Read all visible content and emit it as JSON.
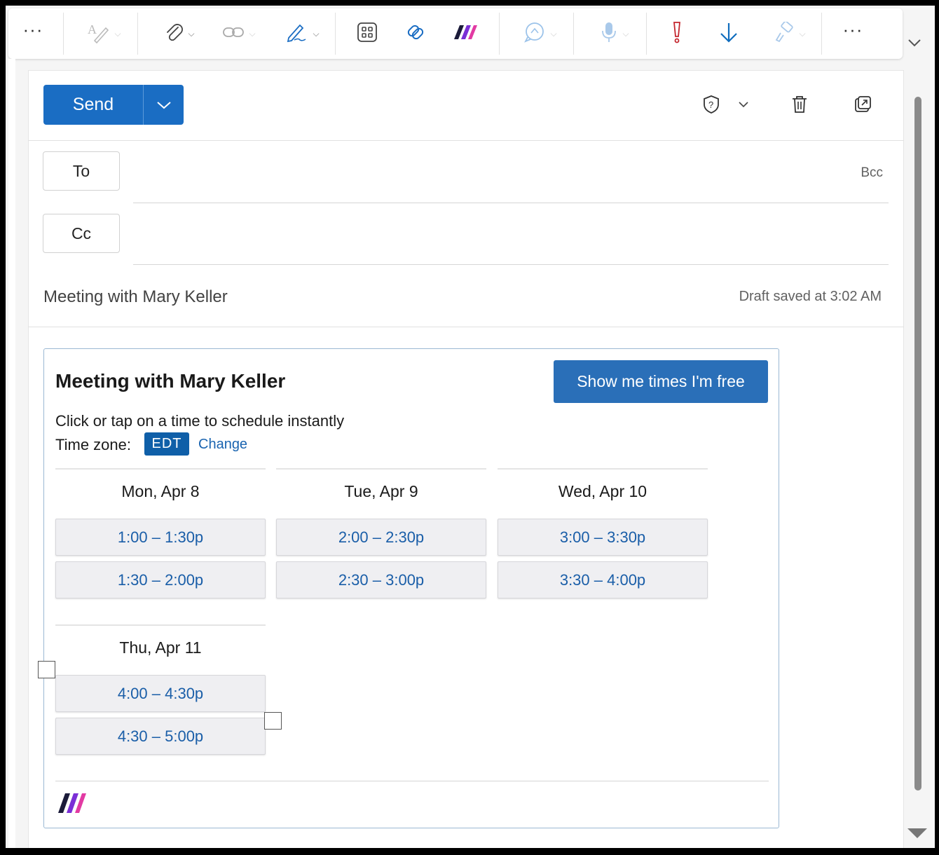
{
  "toolbar": {
    "items": [
      {
        "icon": "more-icon"
      },
      {
        "icon": "editor-icon"
      },
      {
        "icon": "attach-icon"
      },
      {
        "icon": "link-icon"
      },
      {
        "icon": "signature-icon"
      },
      {
        "icon": "apps-icon"
      },
      {
        "icon": "loop-icon"
      },
      {
        "icon": "meeting-scheduler-addin-icon"
      },
      {
        "icon": "chat-icon"
      },
      {
        "icon": "dictate-icon"
      },
      {
        "icon": "high-importance-icon",
        "color": "#c4262e"
      },
      {
        "icon": "low-importance-icon",
        "color": "#0f6cbd"
      },
      {
        "icon": "format-painter-icon"
      },
      {
        "icon": "more-icon"
      }
    ]
  },
  "compose": {
    "send_label": "Send",
    "to_label": "To",
    "cc_label": "Cc",
    "bcc_label": "Bcc",
    "subject": "Meeting with Mary Keller",
    "draft_status": "Draft saved at 3:02 AM"
  },
  "card": {
    "title": "Meeting with Mary Keller",
    "free_button": "Show me times I'm free",
    "instruction": "Click or tap on a time to schedule instantly",
    "timezone_label": "Time zone:",
    "timezone_value": "EDT",
    "timezone_change": "Change",
    "days": [
      {
        "label": "Mon, Apr 8",
        "slots": [
          "1:00 – 1:30p",
          "1:30 – 2:00p"
        ]
      },
      {
        "label": "Tue, Apr 9",
        "slots": [
          "2:00 – 2:30p",
          "2:30 – 3:00p"
        ]
      },
      {
        "label": "Wed, Apr 10",
        "slots": [
          "3:00 – 3:30p",
          "3:30 – 4:00p"
        ]
      },
      {
        "label": "Thu, Apr 11",
        "slots": [
          "4:00 – 4:30p",
          "4:30 – 5:00p"
        ]
      }
    ]
  },
  "colors": {
    "send": "#1a6dc3",
    "accent_link": "#1a64b0",
    "badge": "#0f5fa8",
    "brand_purple": "#7b2fd6",
    "brand_pink": "#e23aa3"
  }
}
